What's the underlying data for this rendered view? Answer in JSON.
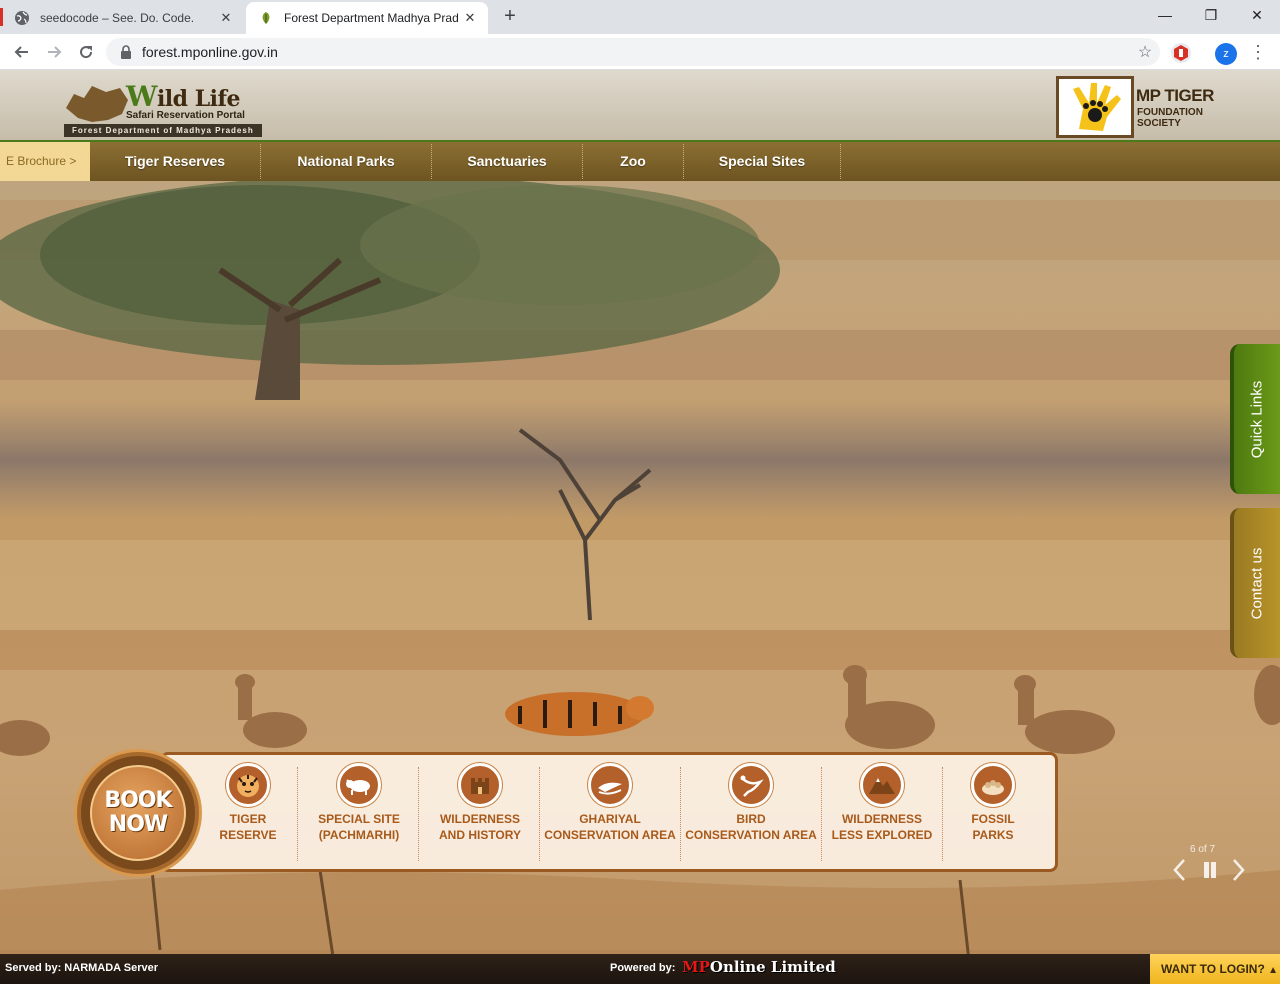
{
  "browser": {
    "tabs": [
      {
        "title": "seedocode – See. Do. Code.",
        "active": false
      },
      {
        "title": "Forest Department Madhya Prad",
        "active": true
      }
    ],
    "new_tab_symbol": "+",
    "window_controls": [
      "—",
      "❐",
      "✕"
    ],
    "url": "forest.mponline.gov.in",
    "profile_initial": "z"
  },
  "header": {
    "logo": {
      "title_initial": "W",
      "title_rest": "ild Life",
      "subtitle": "Safari Reservation Portal",
      "strip": "Forest Department of Madhya Pradesh"
    },
    "tiger_logo": {
      "title": "MP TIGER",
      "sub_line1": "FOUNDATION",
      "sub_line2": "SOCIETY"
    }
  },
  "nav": {
    "brochure": "E Brochure >",
    "items": [
      "Tiger Reserves",
      "National Parks",
      "Sanctuaries",
      "Zoo",
      "Special Sites"
    ]
  },
  "side_tabs": {
    "quick_links": "Quick Links",
    "contact_us": "Contact us"
  },
  "booking": {
    "book_line1": "BOOK",
    "book_line2": "NOW",
    "categories": [
      {
        "line1": "TIGER",
        "line2": "RESERVE",
        "icon": "tiger-icon"
      },
      {
        "line1": "SPECIAL SITE",
        "line2": "(PACHMARHI)",
        "icon": "bison-icon"
      },
      {
        "line1": "WILDERNESS",
        "line2": "AND HISTORY",
        "icon": "fort-icon"
      },
      {
        "line1": "GHARIYAL",
        "line2": "CONSERVATION AREA",
        "icon": "gharial-icon"
      },
      {
        "line1": "BIRD",
        "line2": "CONSERVATION AREA",
        "icon": "bird-icon"
      },
      {
        "line1": "WILDERNESS",
        "line2": "LESS EXPLORED",
        "icon": "mountain-icon"
      },
      {
        "line1": "FOSSIL",
        "line2": "PARKS",
        "icon": "fossil-icon"
      }
    ]
  },
  "slider": {
    "counter": "6 of 7"
  },
  "footer": {
    "served": "Served by: NARMADA Server",
    "powered": "Powered by:",
    "brand_mp": "MP",
    "brand_rest": "Online Limited",
    "login": "WANT TO LOGIN?"
  },
  "colors": {
    "nav_bg": "#7c6229",
    "accent_green": "#4a7a1a",
    "book_brown": "#9b5a22",
    "login_yellow": "#f5c232"
  }
}
